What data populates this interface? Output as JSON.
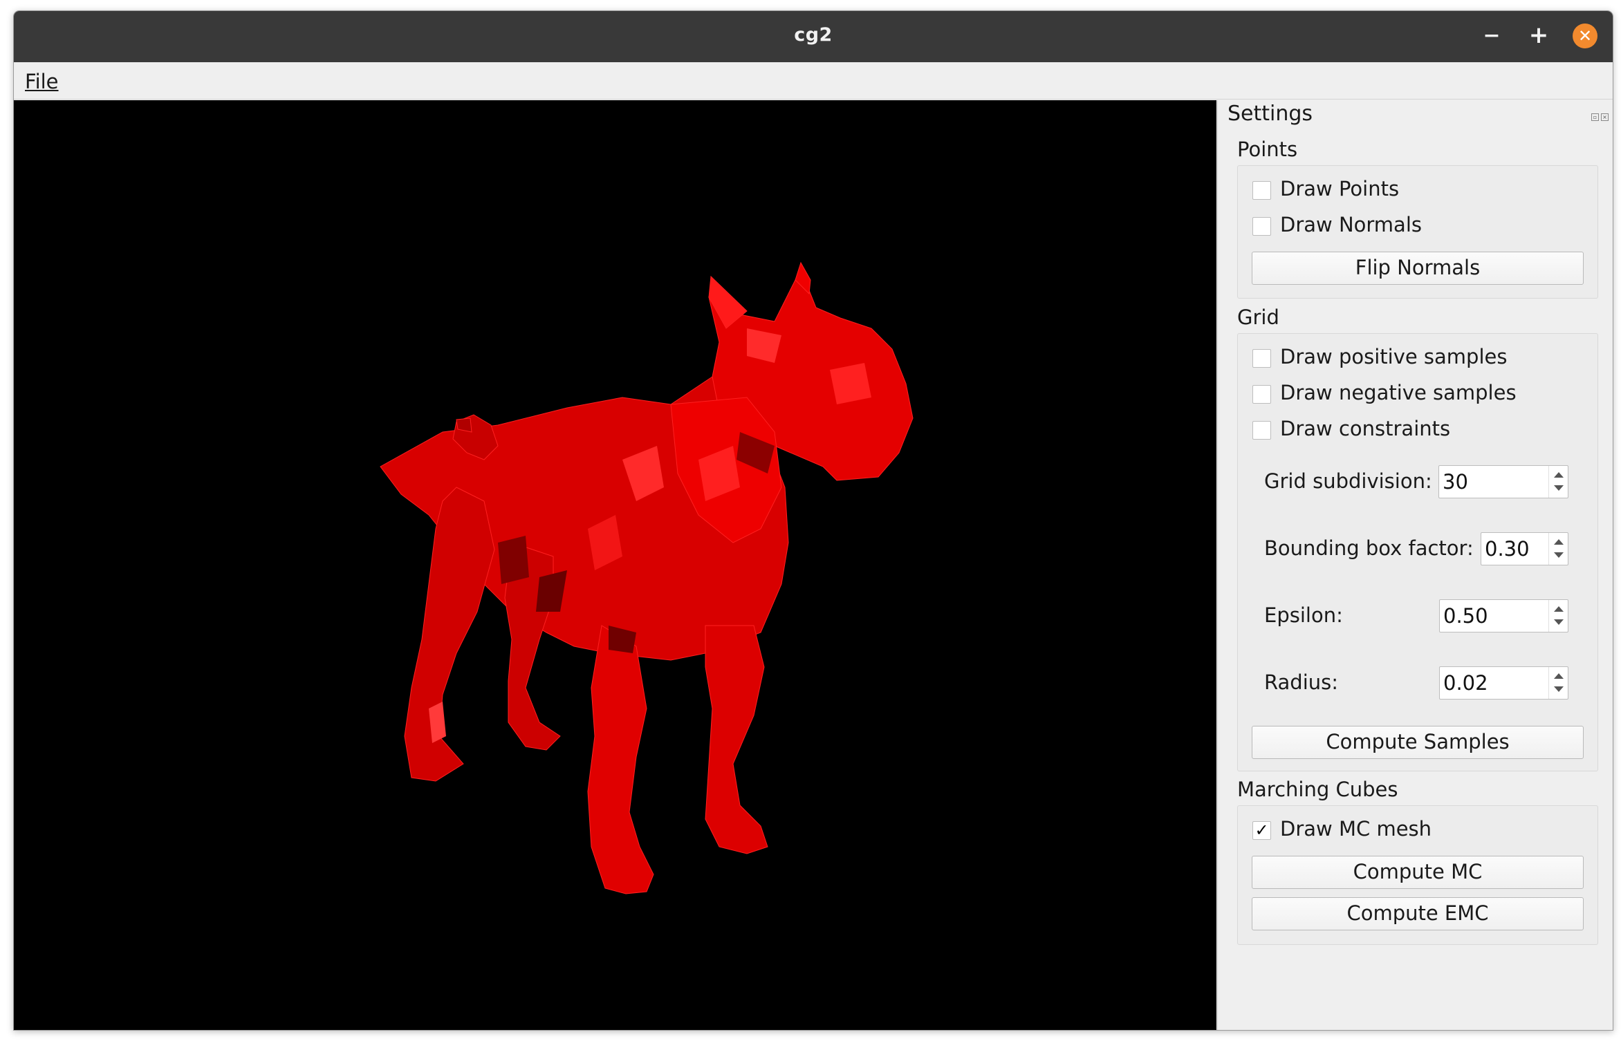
{
  "window": {
    "title": "cg2"
  },
  "menubar": {
    "file": "File"
  },
  "viewport": {
    "mesh_color": "#ff0000",
    "background": "#000000"
  },
  "settings": {
    "title": "Settings",
    "points": {
      "title": "Points",
      "draw_points": {
        "label": "Draw Points",
        "checked": false
      },
      "draw_normals": {
        "label": "Draw Normals",
        "checked": false
      },
      "flip_normals": "Flip Normals"
    },
    "grid": {
      "title": "Grid",
      "draw_positive": {
        "label": "Draw positive samples",
        "checked": false
      },
      "draw_negative": {
        "label": "Draw negative samples",
        "checked": false
      },
      "draw_constraints": {
        "label": "Draw constraints",
        "checked": false
      },
      "subdivision": {
        "label": "Grid subdivision:",
        "value": "30"
      },
      "bbox_factor": {
        "label": "Bounding box factor:",
        "value": "0.30"
      },
      "epsilon": {
        "label": "Epsilon:",
        "value": "0.50"
      },
      "radius": {
        "label": "Radius:",
        "value": "0.02"
      },
      "compute_samples": "Compute Samples"
    },
    "mc": {
      "title": "Marching Cubes",
      "draw_mesh": {
        "label": "Draw MC mesh",
        "checked": true,
        "mark": "✓"
      },
      "compute_mc": "Compute MC",
      "compute_emc": "Compute EMC"
    }
  }
}
